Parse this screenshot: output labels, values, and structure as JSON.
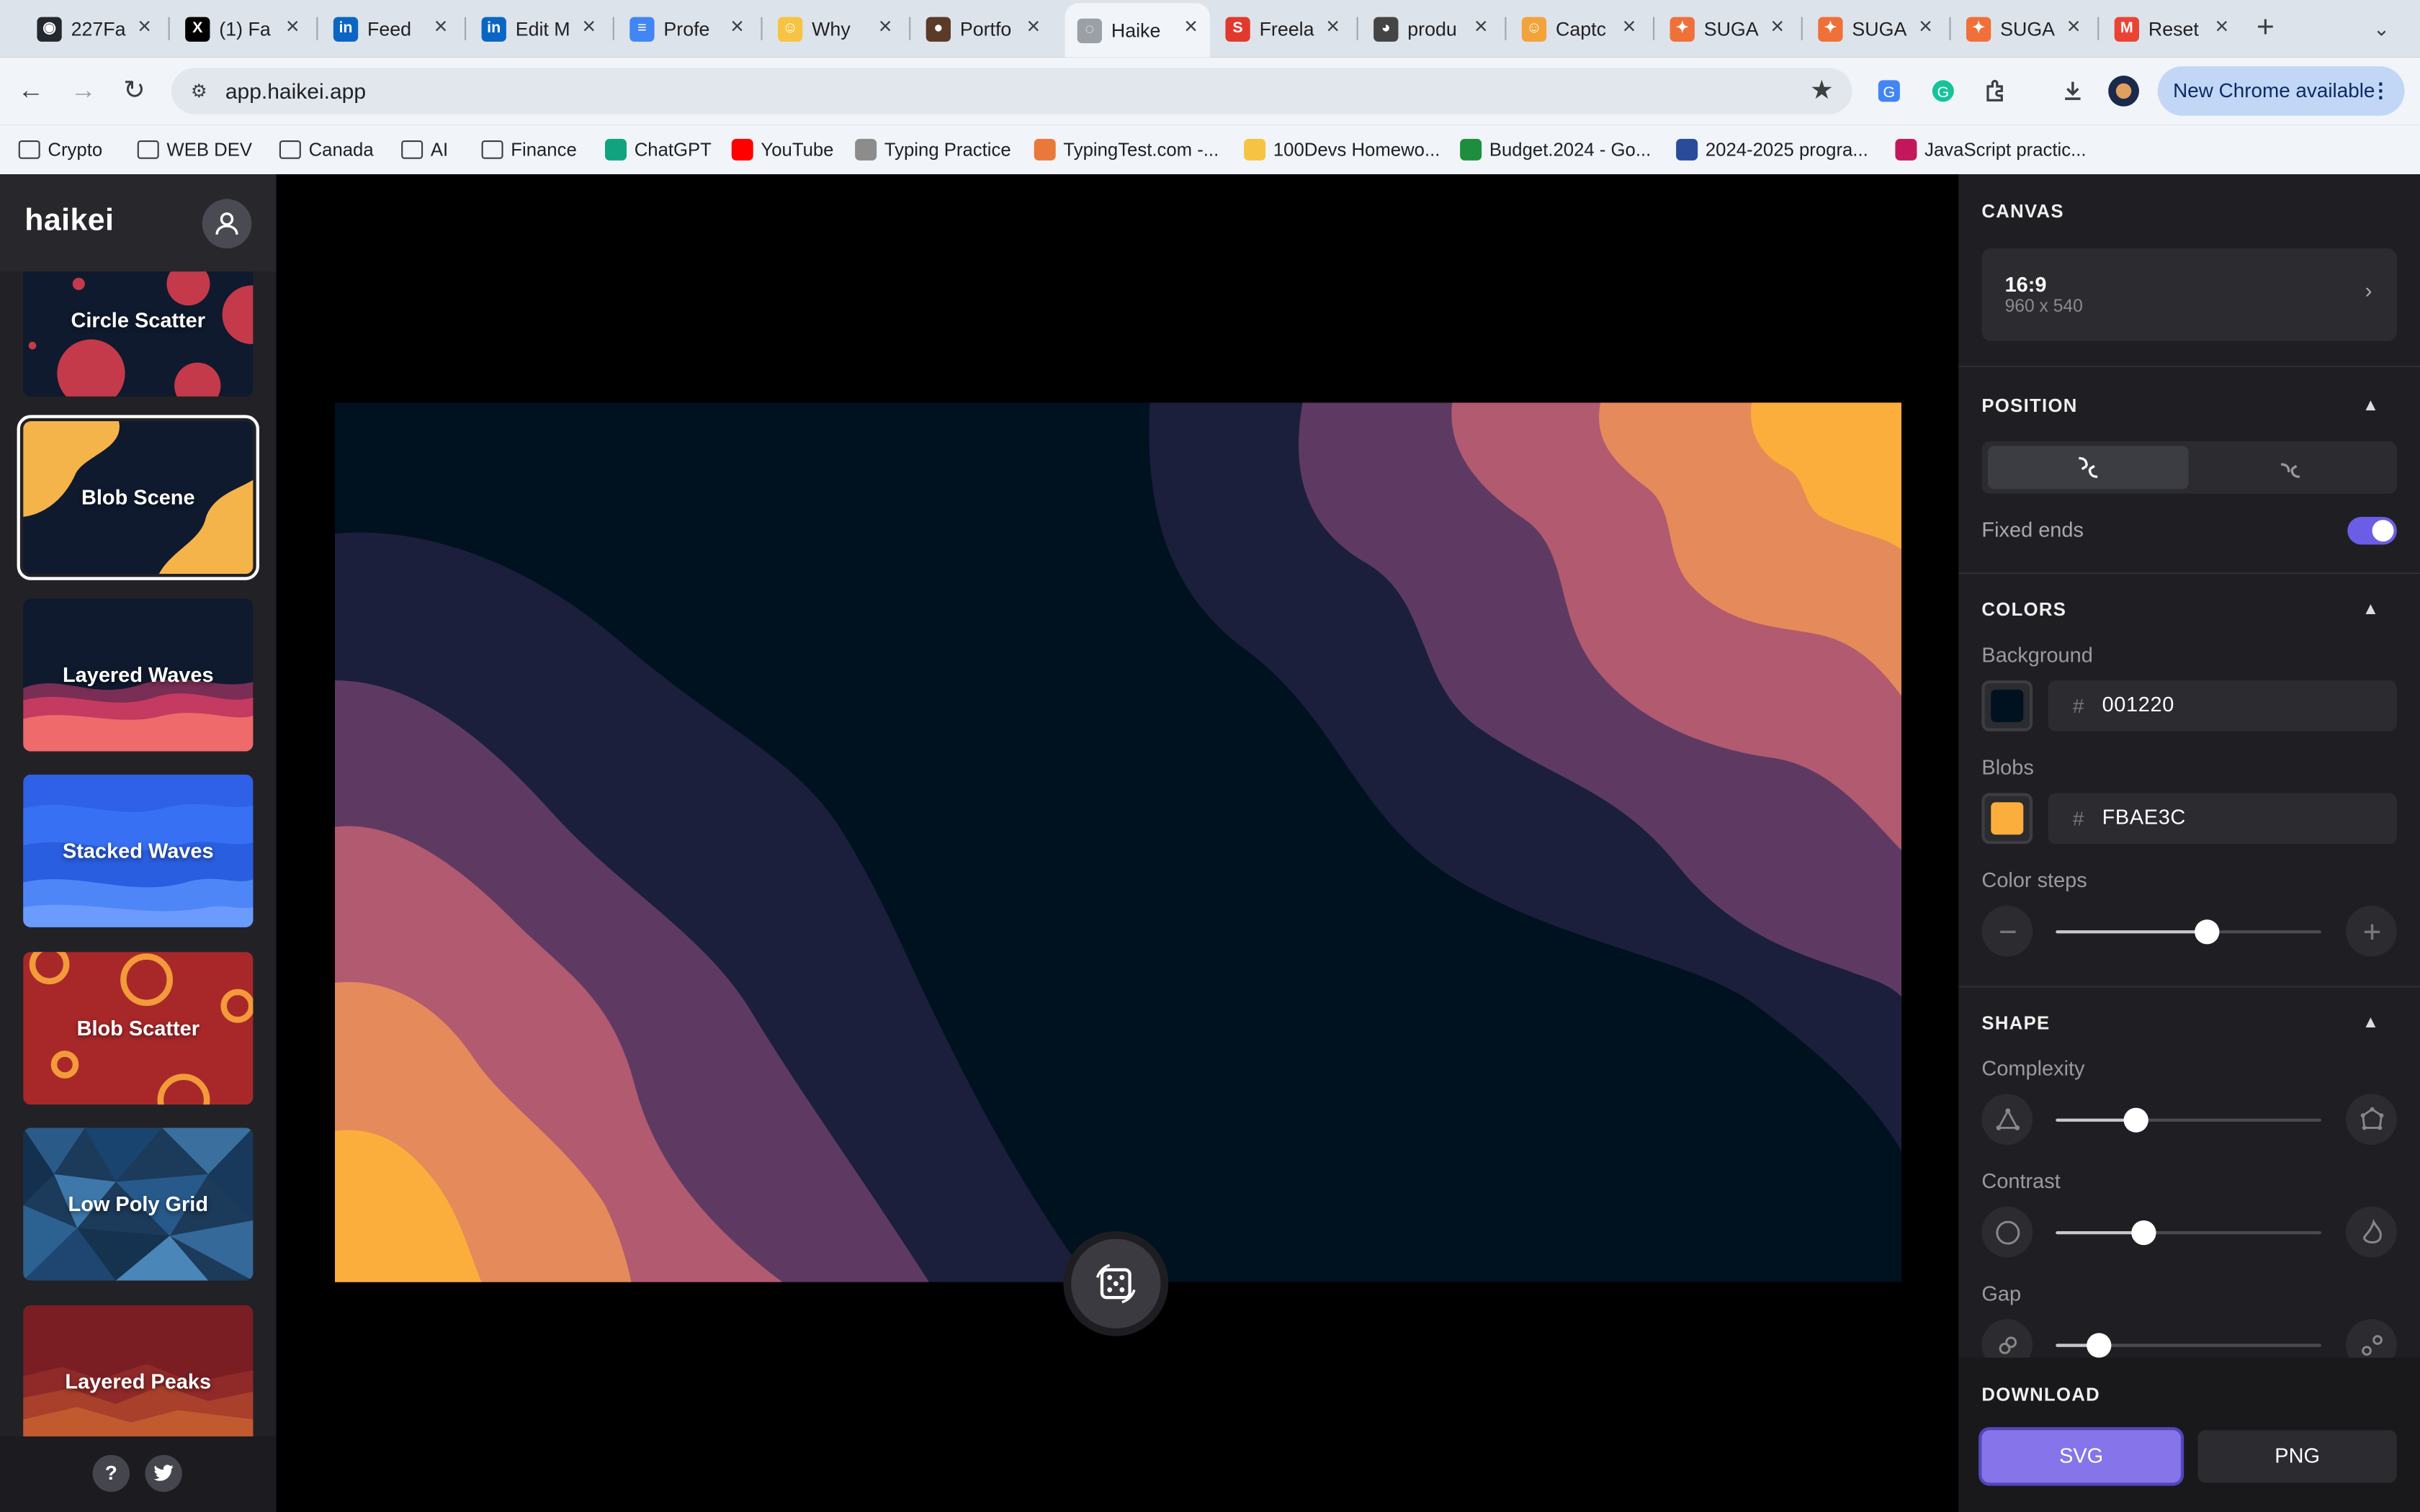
{
  "browser": {
    "tabs": [
      {
        "title": "227Fa",
        "favicon": "github-icon",
        "color": "#24292f",
        "glyph": "◉"
      },
      {
        "title": "(1) Fa",
        "favicon": "x-icon",
        "color": "#000000",
        "glyph": "X"
      },
      {
        "title": "Feed",
        "favicon": "linkedin-icon",
        "color": "#0a66c2",
        "glyph": "in"
      },
      {
        "title": "Edit M",
        "favicon": "linkedin-icon",
        "color": "#0a66c2",
        "glyph": "in"
      },
      {
        "title": "Profe",
        "favicon": "docs-icon",
        "color": "#4285f4",
        "glyph": "≡"
      },
      {
        "title": "Why",
        "favicon": "emoji-icon",
        "color": "#f6c343",
        "glyph": "☺"
      },
      {
        "title": "Portfo",
        "favicon": "person-icon",
        "color": "#5b3a29",
        "glyph": "●"
      },
      {
        "title": "Haike",
        "favicon": "globe-icon",
        "color": "#9aa0a6",
        "glyph": "◌"
      },
      {
        "title": "Freela",
        "favicon": "s-icon",
        "color": "#e03a2e",
        "glyph": "S"
      },
      {
        "title": "produ",
        "favicon": "panda-icon",
        "color": "#444444",
        "glyph": "◕"
      },
      {
        "title": "Captc",
        "favicon": "emoji-icon",
        "color": "#f2a33a",
        "glyph": "☺"
      },
      {
        "title": "SUGA",
        "favicon": "sugar-icon",
        "color": "#f0703a",
        "glyph": "✦"
      },
      {
        "title": "SUGA",
        "favicon": "sugar-icon",
        "color": "#f0703a",
        "glyph": "✦"
      },
      {
        "title": "SUGA",
        "favicon": "sugar-icon",
        "color": "#f0703a",
        "glyph": "✦"
      },
      {
        "title": "Reset",
        "favicon": "gmail-icon",
        "color": "#ea4335",
        "glyph": "M"
      }
    ],
    "active_tab_index": 7,
    "url": "app.haikei.app",
    "update_label": "New Chrome available",
    "bookmarks": [
      {
        "label": "Crypto",
        "type": "folder"
      },
      {
        "label": "WEB DEV",
        "type": "folder"
      },
      {
        "label": "Canada",
        "type": "folder"
      },
      {
        "label": "AI",
        "type": "folder"
      },
      {
        "label": "Finance",
        "type": "folder"
      },
      {
        "label": "ChatGPT",
        "type": "site",
        "color": "#10a37f"
      },
      {
        "label": "YouTube",
        "type": "site",
        "color": "#ff0000"
      },
      {
        "label": "Typing Practice",
        "type": "site",
        "color": "#8c8c8c"
      },
      {
        "label": "TypingTest.com -...",
        "type": "site",
        "color": "#e8793a"
      },
      {
        "label": "100Devs Homewo...",
        "type": "site",
        "color": "#f6c343"
      },
      {
        "label": "Budget.2024 - Go...",
        "type": "site",
        "color": "#1e8e3e"
      },
      {
        "label": "2024-2025 progra...",
        "type": "site",
        "color": "#2a4a9a"
      },
      {
        "label": "JavaScript practic...",
        "type": "site",
        "color": "#c2185b"
      }
    ]
  },
  "app": {
    "logo": "haikei",
    "generators": [
      {
        "label": "Circle Scatter",
        "selected": false
      },
      {
        "label": "Blob Scene",
        "selected": true
      },
      {
        "label": "Layered Waves",
        "selected": false
      },
      {
        "label": "Stacked Waves",
        "selected": false
      },
      {
        "label": "Blob Scatter",
        "selected": false
      },
      {
        "label": "Low Poly Grid",
        "selected": false
      },
      {
        "label": "Layered Peaks",
        "selected": false
      }
    ],
    "footer": {
      "help": "?"
    }
  },
  "panel": {
    "canvas": {
      "title": "CANVAS",
      "ratio": "16:9",
      "dims": "960 x 540"
    },
    "position": {
      "title": "POSITION",
      "fixed_ends_label": "Fixed ends",
      "fixed_ends": true
    },
    "colors": {
      "title": "COLORS",
      "background_label": "Background",
      "background_hex": "001220",
      "background_color": "#001220",
      "blobs_label": "Blobs",
      "blobs_hex": "FBAE3C",
      "blobs_color": "#FBAE3C",
      "steps_label": "Color steps",
      "steps_level": 0.57
    },
    "shape": {
      "title": "SHAPE",
      "complexity_label": "Complexity",
      "complexity_level": 0.3,
      "contrast_label": "Contrast",
      "contrast_level": 0.33,
      "gap_label": "Gap",
      "gap_level": 0.16
    },
    "download": {
      "title": "DOWNLOAD",
      "svg_label": "SVG",
      "png_label": "PNG"
    }
  },
  "artwork": {
    "palette": [
      "#001220",
      "#1b1f3b",
      "#5e3a63",
      "#b25a70",
      "#e58a5a",
      "#fbae3c"
    ]
  }
}
